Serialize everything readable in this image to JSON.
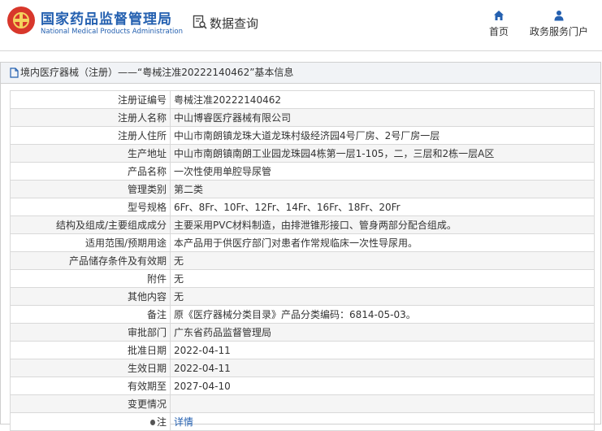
{
  "header": {
    "brand_cn": "国家药品监督管理局",
    "brand_en": "National Medical Products Administration",
    "query_label": "数据查询",
    "nav": [
      {
        "label": "首页",
        "icon": "home-icon"
      },
      {
        "label": "政务服务门户",
        "icon": "user-icon"
      }
    ]
  },
  "panel": {
    "title": "境内医疗器械（注册）——“粤械注准20222140462”基本信息"
  },
  "rows": [
    {
      "key": "注册证编号",
      "value": "粤械注准20222140462"
    },
    {
      "key": "注册人名称",
      "value": "中山博睿医疗器械有限公司"
    },
    {
      "key": "注册人住所",
      "value": "中山市南朗镇龙珠大道龙珠村级经济园4号厂房、2号厂房一层"
    },
    {
      "key": "生产地址",
      "value": "中山市南朗镇南朗工业园龙珠园4栋第一层1-105，二，三层和2栋一层A区"
    },
    {
      "key": "产品名称",
      "value": "一次性使用单腔导尿管"
    },
    {
      "key": "管理类别",
      "value": "第二类"
    },
    {
      "key": "型号规格",
      "value": "6Fr、8Fr、10Fr、12Fr、14Fr、16Fr、18Fr、20Fr"
    },
    {
      "key": "结构及组成/主要组成成分",
      "value": "主要采用PVC材料制造，由排泄锥形接口、管身两部分配合组成。"
    },
    {
      "key": "适用范围/预期用途",
      "value": "本产品用于供医疗部门对患者作常规临床一次性导尿用。"
    },
    {
      "key": "产品储存条件及有效期",
      "value": "无"
    },
    {
      "key": "附件",
      "value": "无"
    },
    {
      "key": "其他内容",
      "value": "无"
    },
    {
      "key": "备注",
      "value": "原《医疗器械分类目录》产品分类编码：6814-05-03。"
    },
    {
      "key": "审批部门",
      "value": "广东省药品监督管理局"
    },
    {
      "key": "批准日期",
      "value": "2022-04-11"
    },
    {
      "key": "生效日期",
      "value": "2022-04-11"
    },
    {
      "key": "有效期至",
      "value": "2027-04-10"
    },
    {
      "key": "变更情况",
      "value": ""
    },
    {
      "key": "注",
      "value": "详情"
    }
  ],
  "colors": {
    "brand": "#2460b0",
    "logo_red": "#d8372b",
    "logo_gold": "#f4d35e"
  }
}
